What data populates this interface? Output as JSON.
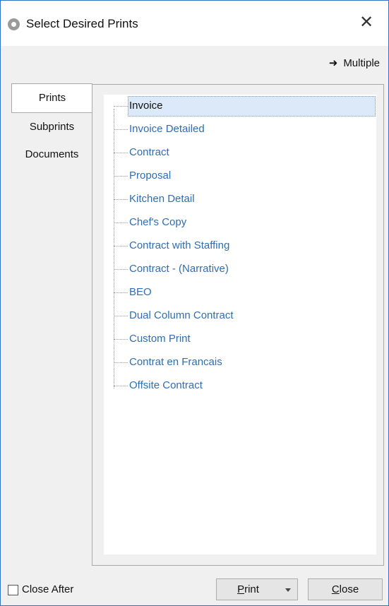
{
  "window": {
    "title": "Select Desired Prints"
  },
  "toolbar": {
    "multiple_label": "Multiple"
  },
  "tabs": [
    {
      "label": "Prints",
      "active": true
    },
    {
      "label": "Subprints",
      "active": false
    },
    {
      "label": "Documents",
      "active": false
    }
  ],
  "tree": {
    "items": [
      {
        "label": "Invoice",
        "selected": true
      },
      {
        "label": "Invoice Detailed"
      },
      {
        "label": "Contract"
      },
      {
        "label": "Proposal"
      },
      {
        "label": "Kitchen Detail"
      },
      {
        "label": "Chef's Copy"
      },
      {
        "label": "Contract with Staffing"
      },
      {
        "label": "Contract - (Narrative)"
      },
      {
        "label": "BEO"
      },
      {
        "label": "Dual Column Contract"
      },
      {
        "label": "Custom Print"
      },
      {
        "label": "Contrat en Francais"
      },
      {
        "label": "Offsite Contract"
      }
    ]
  },
  "footer": {
    "close_after_label": "Close After",
    "close_after_checked": false,
    "print_label_rest": "rint",
    "print_mnemonic": "P",
    "close_label_rest": "lose",
    "close_mnemonic": "C"
  },
  "colors": {
    "accent": "#2f73c7",
    "link_text": "#2f6db2",
    "selection": "#dbe9f8"
  }
}
